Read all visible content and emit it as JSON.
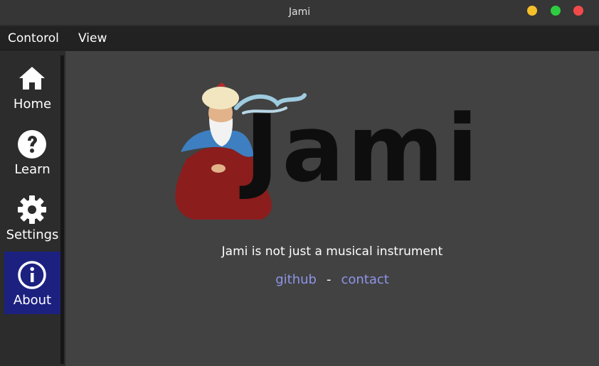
{
  "window": {
    "title": "Jami"
  },
  "menu": {
    "items": [
      "Contorol",
      "View"
    ]
  },
  "sidebar": {
    "items": [
      {
        "label": "Home",
        "icon": "home-icon"
      },
      {
        "label": "Learn",
        "icon": "help-icon"
      },
      {
        "label": "Settings",
        "icon": "gear-icon"
      },
      {
        "label": "About",
        "icon": "info-icon",
        "active": true
      }
    ]
  },
  "about": {
    "logo_text": "Jami",
    "tagline": "Jami is not just a musical instrument",
    "links": {
      "github": "github",
      "separator": "-",
      "contact": "contact"
    }
  },
  "colors": {
    "active_nav": "#1c2180",
    "link": "#8e95e8",
    "content_bg": "#424242",
    "menubar_bg": "#222222"
  }
}
